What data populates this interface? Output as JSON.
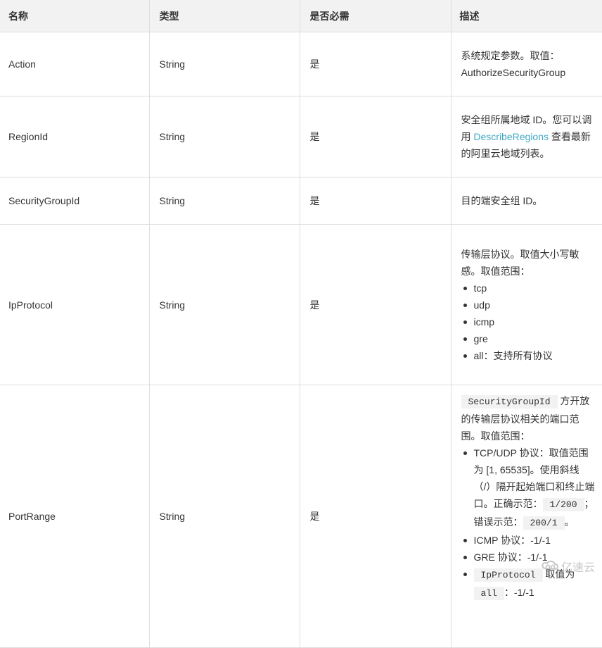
{
  "table": {
    "headers": [
      "名称",
      "类型",
      "是否必需",
      "描述"
    ],
    "rows": [
      {
        "name": "Action",
        "type": "String",
        "required": "是",
        "description": {
          "text": "系统规定参数。取值：AuthorizeSecurityGroup"
        }
      },
      {
        "name": "RegionId",
        "type": "String",
        "required": "是",
        "description": {
          "before": "安全组所属地域 ID。您可以调用 ",
          "link": "DescribeRegions",
          "after": " 查看最新的阿里云地域列表。"
        }
      },
      {
        "name": "SecurityGroupId",
        "type": "String",
        "required": "是",
        "description": {
          "text": "目的端安全组 ID。"
        }
      },
      {
        "name": "IpProtocol",
        "type": "String",
        "required": "是",
        "description": {
          "intro": "传输层协议。取值大小写敏感。取值范围：",
          "options": [
            "tcp",
            "udp",
            "icmp",
            "gre",
            "all：支持所有协议"
          ]
        }
      },
      {
        "name": "PortRange",
        "type": "String",
        "required": "是",
        "description": {
          "intro_code": "SecurityGroupId",
          "intro_text": " 方开放的传输层协议相关的端口范围。取值范围：",
          "tcp_udp": {
            "text": "TCP/UDP 协议：取值范围为 [1, 65535]。使用斜线（/）隔开起始端口和终止端口。正确示范：",
            "correct_example": "1/200",
            "wrong_label": "；错误示范：",
            "wrong_example": "200/1",
            "end": "。"
          },
          "icmp": "ICMP 协议：-1/-1",
          "gre": "GRE 协议：-1/-1",
          "all": {
            "code1": "IpProtocol",
            "text": " 取值为 ",
            "code2": "all",
            "value": "：-1/-1"
          }
        }
      }
    ]
  },
  "watermark": {
    "icon": "yisu-cloud-logo-icon",
    "text": "亿速云"
  }
}
